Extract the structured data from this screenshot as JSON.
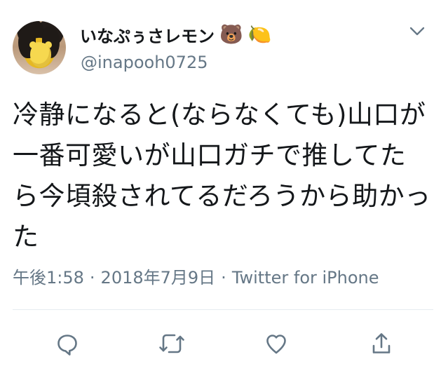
{
  "tweet": {
    "user": {
      "display_name": "いなぷぅさレモン",
      "emojis": [
        "🐻",
        "🍋"
      ],
      "handle": "@inapooh0725"
    },
    "text": "冷静になると(ならなくても)山口が一番可愛いが山口ガチで推してたら今頃殺されてるだろうから助かった",
    "meta": {
      "time": "午後1:58",
      "separator": "·",
      "date": "2018年7月9日",
      "source": "Twitter for iPhone"
    },
    "icons": {
      "menu": "chevron-down-icon",
      "reply": "reply-icon",
      "retweet": "retweet-icon",
      "like": "heart-icon",
      "share": "share-icon"
    },
    "colors": {
      "text": "#14171a",
      "secondary": "#657786",
      "divider": "#e6ecf0",
      "icon": "#657786"
    }
  }
}
